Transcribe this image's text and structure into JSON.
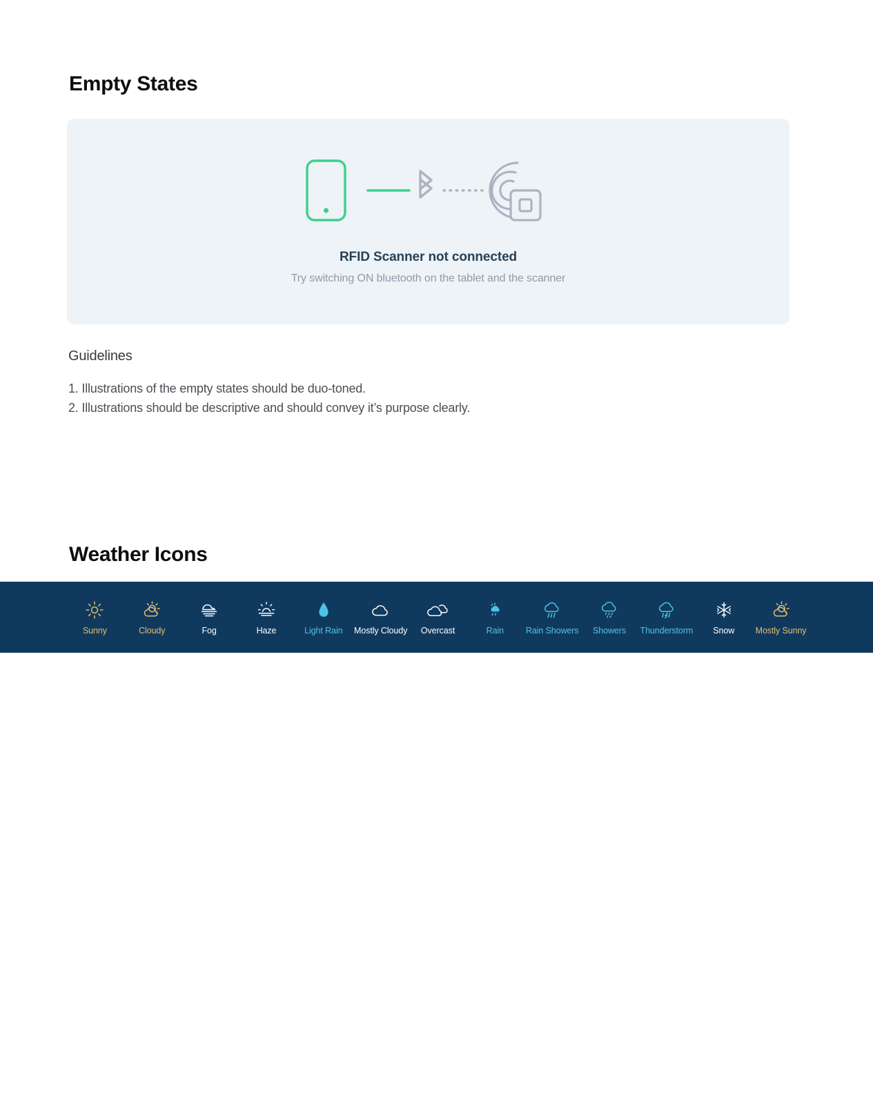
{
  "sections": {
    "empty_states_title": "Empty States",
    "weather_icons_title": "Weather Icons"
  },
  "empty_state": {
    "illustration_name": "tablet-bluetooth-rfid-scanner-illustration",
    "title": "RFID Scanner not connected",
    "subtitle": "Try switching ON bluetooth on the tablet and the scanner",
    "background_color": "#eef3f7",
    "accent_color": "#3ecf8e",
    "muted_color": "#aab4c0"
  },
  "guidelines": {
    "heading": "Guidelines",
    "items": [
      "1. Illustrations of the empty states should be duo-toned.",
      "2. Illustrations should be descriptive and should convey it’s purpose clearly."
    ]
  },
  "weather": {
    "bar_color": "#103a5d",
    "colors": {
      "gold": "#e8bd6f",
      "white": "#ffffff",
      "cyan": "#4ec3e8"
    },
    "items": [
      {
        "label": "Sunny",
        "icon": "sun-icon",
        "color": "#e8bd6f"
      },
      {
        "label": "Cloudy",
        "icon": "sun-behind-cloud-icon",
        "color": "#e8bd6f"
      },
      {
        "label": "Fog",
        "icon": "fog-icon",
        "color": "#ffffff"
      },
      {
        "label": "Haze",
        "icon": "haze-icon",
        "color": "#ffffff"
      },
      {
        "label": "Light Rain",
        "icon": "raindrop-icon",
        "color": "#4ec3e8"
      },
      {
        "label": "Mostly Cloudy",
        "icon": "cloud-icon",
        "color": "#ffffff"
      },
      {
        "label": "Overcast",
        "icon": "double-cloud-icon",
        "color": "#ffffff"
      },
      {
        "label": "Rain",
        "icon": "small-rain-icon",
        "color": "#4ec3e8"
      },
      {
        "label": "Rain Showers",
        "icon": "cloud-rain-icon",
        "color": "#4ec3e8"
      },
      {
        "label": "Showers",
        "icon": "cloud-drizzle-icon",
        "color": "#4ec3e8"
      },
      {
        "label": "Thunderstorm",
        "icon": "cloud-lightning-rain-icon",
        "color": "#4ec3e8"
      },
      {
        "label": "Snow",
        "icon": "snowflake-icon",
        "color": "#ffffff"
      },
      {
        "label": "Mostly Sunny",
        "icon": "sun-behind-cloud-icon",
        "color": "#e8bd6f"
      }
    ]
  }
}
